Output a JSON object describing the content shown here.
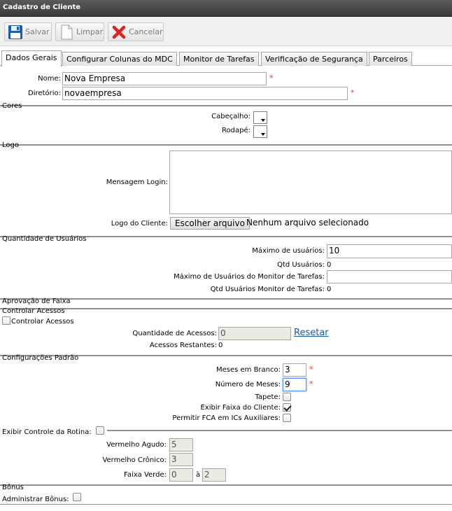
{
  "window": {
    "title": "Cadastro de Cliente"
  },
  "toolbar": {
    "save": "Salvar",
    "clear": "Limpar",
    "cancel": "Cancelar"
  },
  "tabs": [
    {
      "label": "Dados Gerais",
      "active": true
    },
    {
      "label": "Configurar Colunas do MDC"
    },
    {
      "label": "Monitor de Tarefas"
    },
    {
      "label": "Verificação de Segurança"
    },
    {
      "label": "Parceiros"
    }
  ],
  "general": {
    "name_label": "Nome:",
    "name_value": "Nova Empresa",
    "dir_label": "Diretório:",
    "dir_value": "novaempresa",
    "required_mark": "*"
  },
  "colors": {
    "title": "Cores",
    "header_label": "Cabeçalho:",
    "footer_label": "Rodapé:"
  },
  "logo": {
    "title": "Logo",
    "login_msg_label": "Mensagem Login:",
    "login_msg_value": "",
    "client_logo_label": "Logo do Cliente:",
    "file_button": "Escolher arquivo",
    "file_status": "Nenhum arquivo selecionado"
  },
  "users": {
    "title": "Quantidade de Usuários",
    "max_label": "Máximo de usuários:",
    "max_value": "10",
    "qtd_label": "Qtd Usuários:",
    "qtd_value": "0",
    "max_monitor_label": "Máximo de Usuários do Monitor de Tarefas:",
    "max_monitor_value": "",
    "qtd_monitor_label": "Qtd Usuários Monitor de Tarefas:",
    "qtd_monitor_value": "0"
  },
  "approval": {
    "title": "Aprovação de Faixa"
  },
  "access": {
    "title": "Controlar Acessos",
    "checkbox_label": "Controlar Acessos",
    "qty_label": "Quantidade de Acessos:",
    "qty_value": "0",
    "reset_link": "Resetar",
    "remaining_label": "Acessos Restantes:",
    "remaining_value": "0"
  },
  "defaults": {
    "title": "Configurações Padrão",
    "blank_months_label": "Meses em Branco:",
    "blank_months_value": "3",
    "months_label": "Número de Meses:",
    "months_value": "9",
    "carpet_label": "Tapete:",
    "carpet_checked": false,
    "show_band_label": "Exibir Faixa do Cliente:",
    "show_band_checked": true,
    "fca_label": "Permitir FCA em ICs Auxiliares:",
    "fca_checked": false
  },
  "routine": {
    "title": "Exibir Controle da Rotina:",
    "acute_label": "Vermelho Agudo:",
    "acute_value": "5",
    "chronic_label": "Vermelho Crônico:",
    "chronic_value": "3",
    "green_label": "Faixa Verde:",
    "green_from": "0",
    "green_to_label": "à",
    "green_to": "2"
  },
  "bonus": {
    "title": "Bônus",
    "admin_label": "Administrar Bônus:"
  },
  "colors_theme": {
    "titlebar": "#4a4a4a",
    "required": "#e53935",
    "link": "#1a5aaa"
  }
}
